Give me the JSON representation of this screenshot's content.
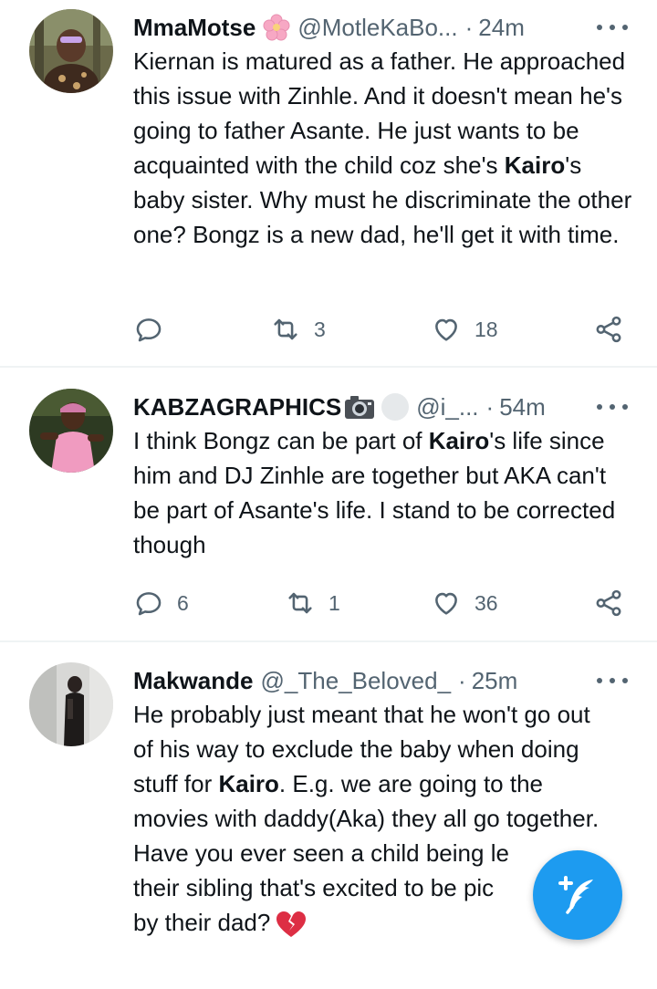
{
  "tweets": [
    {
      "name": "MmaMotse",
      "handle": "@MotleKaBo...",
      "separator": "·",
      "time": "24m",
      "text_parts": [
        "Kiernan is matured as a father. He approached this issue with Zinhle. And it doesn't mean he's going to father Asante. He just wants to be acquainted with the child coz she's ",
        "Kairo",
        "'s baby sister. Why must he discriminate the other one? Bongz is a new dad, he'll get it with time."
      ],
      "replies": "",
      "retweets": "3",
      "likes": "18"
    },
    {
      "name": "KABZAGRAPHICS",
      "handle": "@i_...",
      "separator": "·",
      "time": "54m",
      "text_parts": [
        "I think Bongz can be part of ",
        "Kairo",
        "'s life since him and DJ Zinhle are together but AKA can't be part of Asante's life. I stand to be corrected though"
      ],
      "replies": "6",
      "retweets": "1",
      "likes": "36"
    },
    {
      "name": "Makwande",
      "handle": "@_The_Beloved_",
      "separator": "·",
      "time": "25m",
      "text_parts": [
        "He probably just meant that he won't go out of his way to exclude the baby when doing stuff for ",
        "Kairo",
        ". E.g. we are going to the movies with daddy(Aka) they all go together.",
        "Have you ever seen a child being le",
        "their sibling that's excited to be pic",
        "by their dad?"
      ]
    }
  ],
  "icons": {
    "reply": "reply-icon",
    "retweet": "retweet-icon",
    "like": "heart-icon",
    "share": "share-icon",
    "more": "more-dots-icon",
    "compose": "compose-feather-icon"
  },
  "colors": {
    "text": "#0f1419",
    "secondary": "#536471",
    "accent": "#1d9bf0",
    "divider": "#eff3f4"
  }
}
